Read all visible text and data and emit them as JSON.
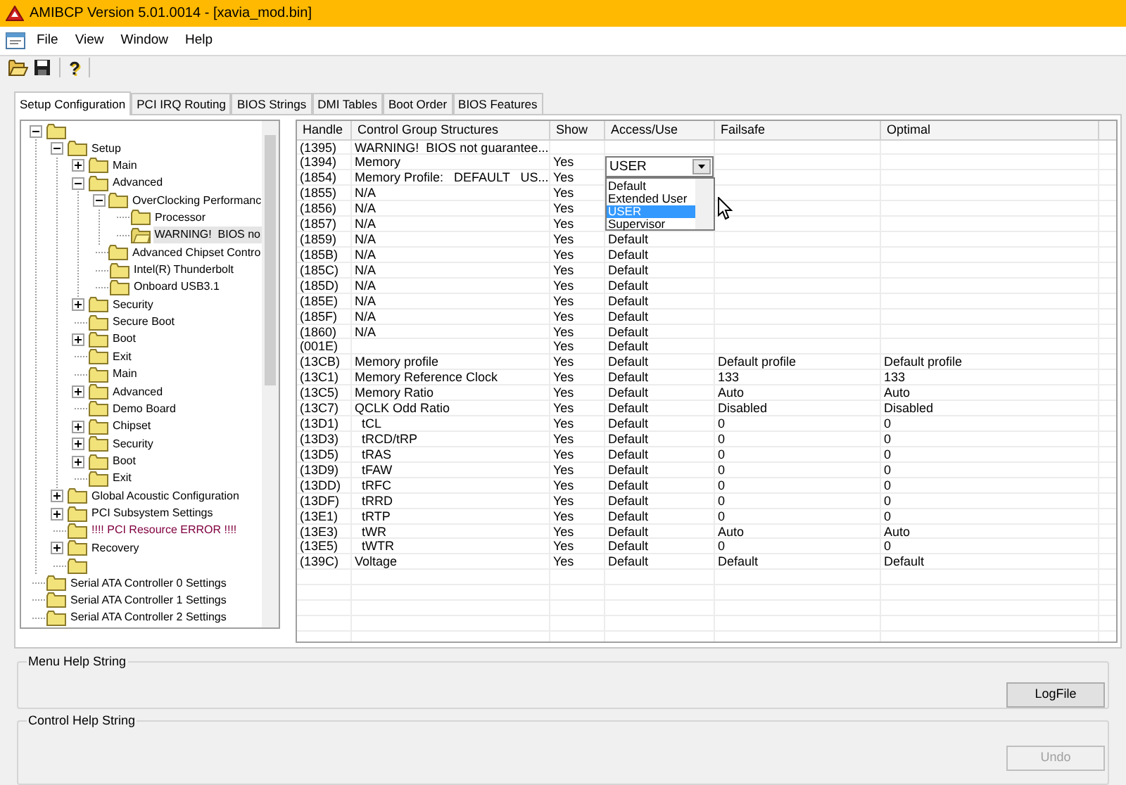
{
  "window": {
    "title": "AMIBCP Version 5.01.0014 - [xavia_mod.bin]"
  },
  "menu": [
    "File",
    "View",
    "Window",
    "Help"
  ],
  "toolbar": {
    "help": "?"
  },
  "tabs": [
    {
      "label": "Setup Configuration",
      "selected": true
    },
    {
      "label": "PCI IRQ Routing",
      "selected": false
    },
    {
      "label": "BIOS Strings",
      "selected": false
    },
    {
      "label": "DMI Tables",
      "selected": false
    },
    {
      "label": "Boot Order",
      "selected": false
    },
    {
      "label": "BIOS Features",
      "selected": false
    }
  ],
  "tree": [
    {
      "expanded": true,
      "selected": false,
      "children": [
        {
          "label": "Setup",
          "expanded": true,
          "selected": false,
          "children": [
            {
              "label": "Main",
              "expanded": false,
              "selected": false
            },
            {
              "label": "Advanced",
              "expanded": true,
              "selected": false,
              "children": [
                {
                  "label": "OverClocking Performanc",
                  "expanded": true,
                  "selected": false,
                  "children": [
                    {
                      "label": "Processor",
                      "selected": false
                    },
                    {
                      "label": "WARNING!  BIOS no",
                      "selected": true
                    }
                  ]
                },
                {
                  "label": "Advanced Chipset Contro",
                  "selected": false
                },
                {
                  "label": "Intel(R) Thunderbolt",
                  "selected": false
                },
                {
                  "label": "Onboard USB3.1",
                  "selected": false
                }
              ]
            },
            {
              "label": "Security",
              "expanded": false,
              "selected": false
            },
            {
              "label": "Secure Boot",
              "selected": false
            },
            {
              "label": "Boot",
              "expanded": false,
              "selected": false
            },
            {
              "label": "Exit",
              "selected": false
            },
            {
              "label": "Main",
              "selected": false
            },
            {
              "label": "Advanced",
              "expanded": false,
              "selected": false
            },
            {
              "label": "Demo Board",
              "selected": false
            },
            {
              "label": "Chipset",
              "expanded": false,
              "selected": false
            },
            {
              "label": "Security",
              "expanded": false,
              "selected": false
            },
            {
              "label": "Boot",
              "expanded": false,
              "selected": false
            },
            {
              "label": "Exit",
              "selected": false
            }
          ]
        },
        {
          "label": "Global Acoustic Configuration",
          "expanded": false,
          "selected": false
        },
        {
          "label": "PCI Subsystem Settings",
          "expanded": false,
          "selected": false
        },
        {
          "label": "!!!! PCI Resource ERROR !!!!",
          "selected": false,
          "error": true
        },
        {
          "label": "Recovery",
          "expanded": false,
          "selected": false
        },
        {
          "selected": false
        }
      ]
    },
    {
      "label": "Serial ATA Controller 0 Settings",
      "selected": false
    },
    {
      "label": "Serial ATA Controller 1 Settings",
      "selected": false
    },
    {
      "label": "Serial ATA Controller 2 Settings",
      "selected": false
    }
  ],
  "table": {
    "columns": [
      "Handle",
      "Control Group Structures",
      "Show",
      "Access/Use",
      "Failsafe",
      "Optimal"
    ],
    "rows": [
      {
        "handle": "(1395)",
        "structure": "WARNING!  BIOS not guarantee..."
      },
      {
        "handle": "(1394)",
        "structure": "Memory",
        "show": "Yes",
        "dropdown": {
          "value": "USER",
          "options": [
            {
              "label": "Default",
              "selected": false
            },
            {
              "label": "Extended User",
              "selected": false
            },
            {
              "label": "USER",
              "selected": true
            },
            {
              "label": "Supervisor",
              "selected": false
            }
          ]
        }
      },
      {
        "handle": "(1854)",
        "structure": "Memory Profile:   DEFAULT   US...",
        "show": "Yes"
      },
      {
        "handle": "(1855)",
        "structure": "N/A",
        "show": "Yes"
      },
      {
        "handle": "(1856)",
        "structure": "N/A",
        "show": "Yes"
      },
      {
        "handle": "(1857)",
        "structure": "N/A",
        "show": "Yes"
      },
      {
        "handle": "(1859)",
        "structure": "N/A",
        "show": "Yes",
        "access": "Default"
      },
      {
        "handle": "(185B)",
        "structure": "N/A",
        "show": "Yes",
        "access": "Default"
      },
      {
        "handle": "(185C)",
        "structure": "N/A",
        "show": "Yes",
        "access": "Default"
      },
      {
        "handle": "(185D)",
        "structure": "N/A",
        "show": "Yes",
        "access": "Default"
      },
      {
        "handle": "(185E)",
        "structure": "N/A",
        "show": "Yes",
        "access": "Default"
      },
      {
        "handle": "(185F)",
        "structure": "N/A",
        "show": "Yes",
        "access": "Default"
      },
      {
        "handle": "(1860)",
        "structure": "N/A",
        "show": "Yes",
        "access": "Default"
      },
      {
        "handle": "(001E)",
        "show": "Yes",
        "access": "Default"
      },
      {
        "handle": "(13CB)",
        "structure": "Memory profile",
        "show": "Yes",
        "access": "Default",
        "failsafe": "Default profile",
        "optimal": "Default profile"
      },
      {
        "handle": "(13C1)",
        "structure": "Memory Reference Clock",
        "show": "Yes",
        "access": "Default",
        "failsafe": "133",
        "optimal": "133"
      },
      {
        "handle": "(13C5)",
        "structure": "Memory Ratio",
        "show": "Yes",
        "access": "Default",
        "failsafe": "Auto",
        "optimal": "Auto"
      },
      {
        "handle": "(13C7)",
        "structure": "QCLK Odd Ratio",
        "show": "Yes",
        "access": "Default",
        "failsafe": "Disabled",
        "optimal": "Disabled"
      },
      {
        "handle": "(13D1)",
        "structure": "  tCL",
        "show": "Yes",
        "access": "Default",
        "failsafe": "0",
        "optimal": "0"
      },
      {
        "handle": "(13D3)",
        "structure": "  tRCD/tRP",
        "show": "Yes",
        "access": "Default",
        "failsafe": "0",
        "optimal": "0"
      },
      {
        "handle": "(13D5)",
        "structure": "  tRAS",
        "show": "Yes",
        "access": "Default",
        "failsafe": "0",
        "optimal": "0"
      },
      {
        "handle": "(13D9)",
        "structure": "  tFAW",
        "show": "Yes",
        "access": "Default",
        "failsafe": "0",
        "optimal": "0"
      },
      {
        "handle": "(13DD)",
        "structure": "  tRFC",
        "show": "Yes",
        "access": "Default",
        "failsafe": "0",
        "optimal": "0"
      },
      {
        "handle": "(13DF)",
        "structure": "  tRRD",
        "show": "Yes",
        "access": "Default",
        "failsafe": "0",
        "optimal": "0"
      },
      {
        "handle": "(13E1)",
        "structure": "  tRTP",
        "show": "Yes",
        "access": "Default",
        "failsafe": "0",
        "optimal": "0"
      },
      {
        "handle": "(13E3)",
        "structure": "  tWR",
        "show": "Yes",
        "access": "Default",
        "failsafe": "Auto",
        "optimal": "Auto"
      },
      {
        "handle": "(13E5)",
        "structure": "  tWTR",
        "show": "Yes",
        "access": "Default",
        "failsafe": "0",
        "optimal": "0"
      },
      {
        "handle": "(139C)",
        "structure": "Voltage",
        "show": "Yes",
        "access": "Default",
        "failsafe": "Default",
        "optimal": "Default"
      }
    ]
  },
  "menu_help": {
    "label": "Menu Help String",
    "button": {
      "label": "LogFile",
      "disabled": false
    }
  },
  "control_help": {
    "label": "Control Help String",
    "button": {
      "label": "Undo",
      "disabled": true
    }
  }
}
